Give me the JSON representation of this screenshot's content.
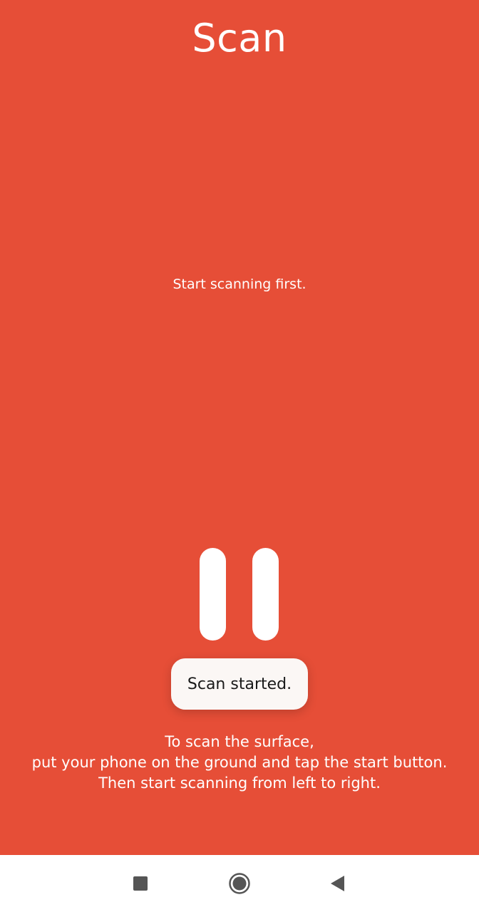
{
  "header": {
    "title": "Scan"
  },
  "main": {
    "status": "Start scanning first.",
    "toast": "Scan started.",
    "instructions": [
      "To scan the surface,",
      "put your phone on the ground and tap the start button.",
      "Then start scanning from left to right."
    ]
  },
  "control": {
    "icon": "pause-icon",
    "state": "scanning"
  },
  "navbar": {
    "recents_icon": "square-icon",
    "home_icon": "circle-icon",
    "back_icon": "triangle-back-icon"
  },
  "colors": {
    "background": "#e64e37",
    "text": "#ffffff",
    "toast_bg": "#fbf7f5",
    "toast_text": "#1a1a1a",
    "navbar_bg": "#ffffff",
    "nav_icon": "#555555"
  }
}
